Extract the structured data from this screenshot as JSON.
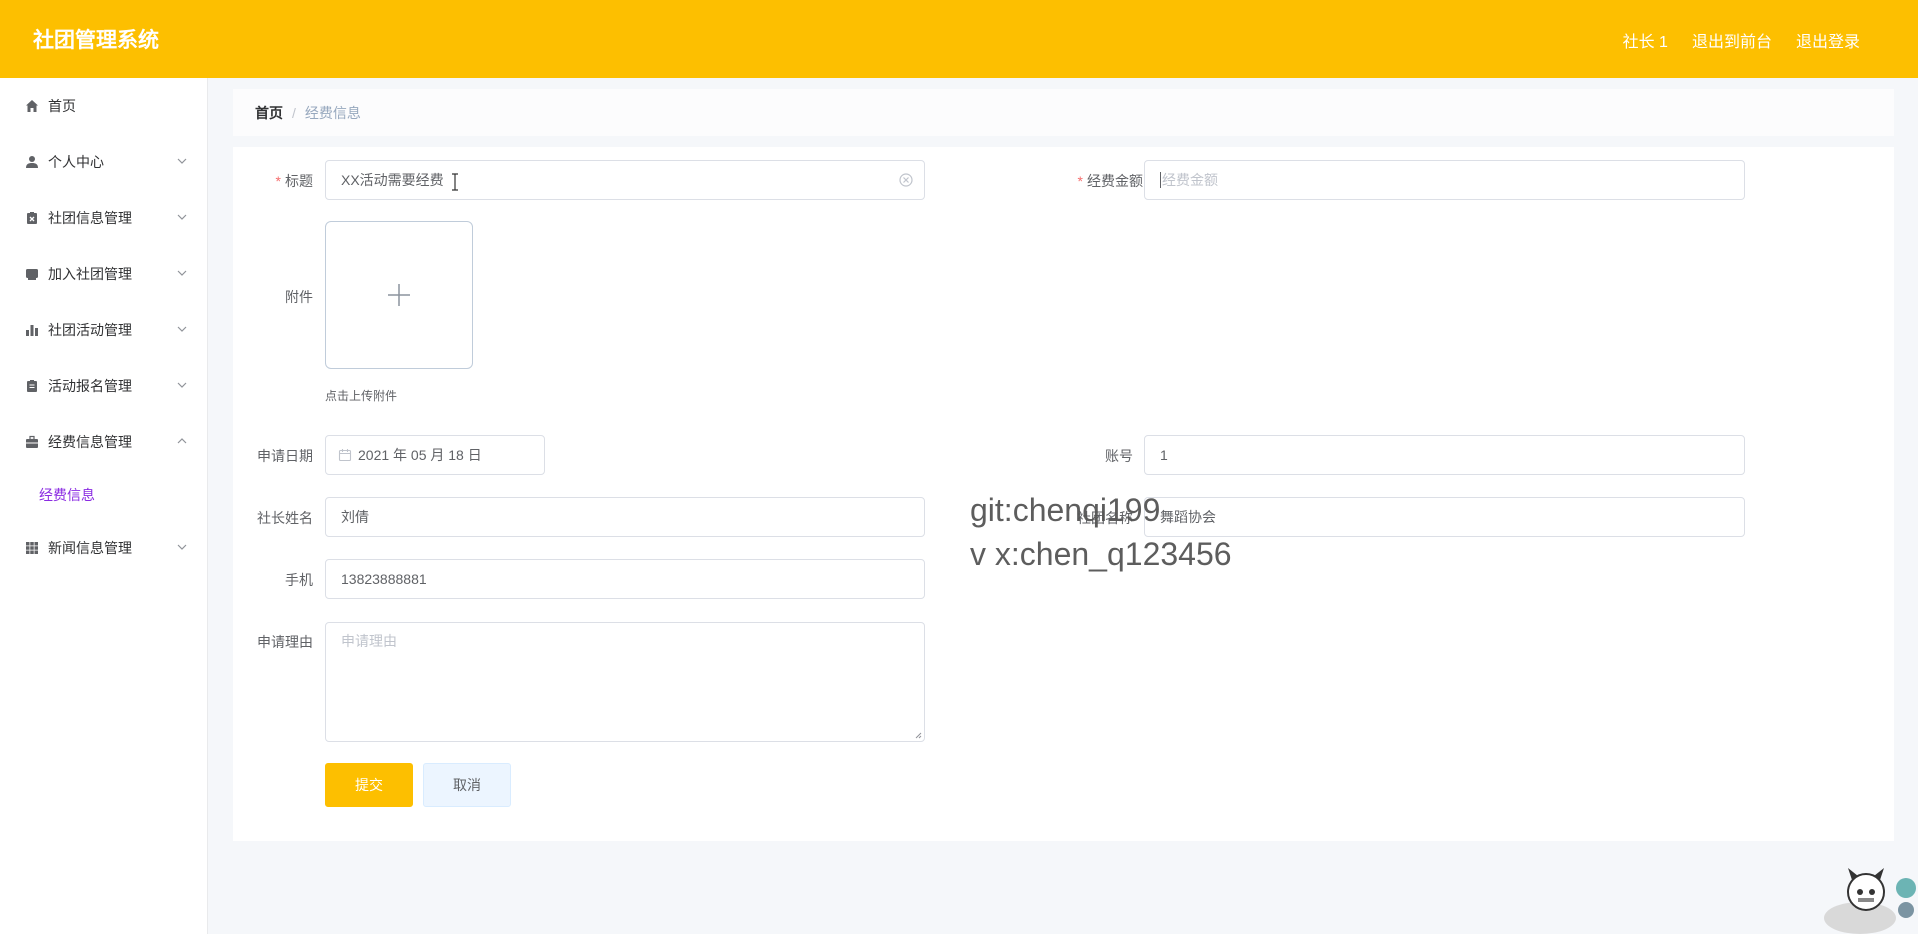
{
  "header": {
    "brand": "社团管理系统",
    "links": [
      "社长 1",
      "退出到前台",
      "退出登录"
    ],
    "bg_color": "#fdbf00"
  },
  "sidebar": {
    "items": [
      {
        "label": "首页",
        "icon": "home-icon",
        "expandable": false
      },
      {
        "label": "个人中心",
        "icon": "user-icon",
        "expandable": true
      },
      {
        "label": "社团信息管理",
        "icon": "clipboard-x-icon",
        "expandable": true
      },
      {
        "label": "加入社团管理",
        "icon": "inbox-icon",
        "expandable": true
      },
      {
        "label": "社团活动管理",
        "icon": "bar-chart-icon",
        "expandable": true
      },
      {
        "label": "活动报名管理",
        "icon": "clipboard-icon",
        "expandable": true
      },
      {
        "label": "经费信息管理",
        "icon": "briefcase-icon",
        "expandable": true,
        "expanded": true,
        "children": [
          "经费信息"
        ]
      },
      {
        "label": "新闻信息管理",
        "icon": "grid-icon",
        "expandable": true
      }
    ],
    "active_color": "#8a2be2"
  },
  "breadcrumb": {
    "home": "首页",
    "separator": "/",
    "current": "经费信息"
  },
  "form": {
    "title": {
      "label": "标题",
      "value": "XX活动需要经费"
    },
    "amount": {
      "label": "经费金额",
      "placeholder": "经费金额"
    },
    "attachment": {
      "label": "附件",
      "tip": "点击上传附件"
    },
    "apply_date": {
      "label": "申请日期",
      "value": "2021 年 05 月 18 日"
    },
    "account": {
      "label": "账号",
      "value": "1"
    },
    "leader_name": {
      "label": "社长姓名",
      "value": "刘倩"
    },
    "club_name": {
      "label": "社团名称",
      "value": "舞蹈协会"
    },
    "phone": {
      "label": "手机",
      "value": "13823888881"
    },
    "reason": {
      "label": "申请理由",
      "placeholder": "申请理由"
    },
    "submit": "提交",
    "cancel": "取消"
  },
  "watermark": {
    "line1": "git:chenqi199",
    "line2": "v x:chen_q123456"
  }
}
